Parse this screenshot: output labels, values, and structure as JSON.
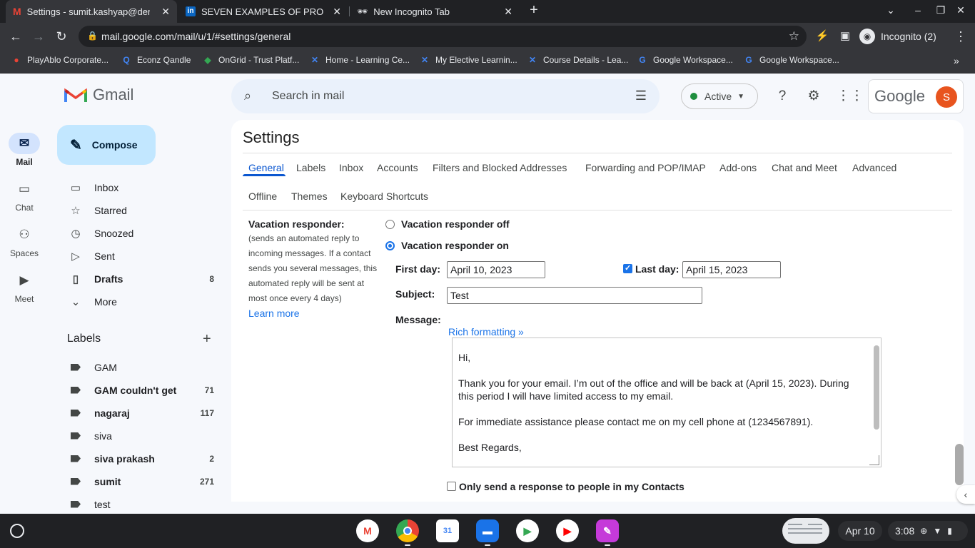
{
  "browser": {
    "tabs": [
      {
        "title": "Settings - sumit.kashyap@demo",
        "icon": "gmail-icon"
      },
      {
        "title": "SEVEN EXAMPLES OF PROFESS",
        "icon": "linkedin-icon"
      },
      {
        "title": "New Incognito Tab",
        "icon": "incognito-icon"
      }
    ],
    "url": "mail.google.com/mail/u/1/#settings/general",
    "profile_label": "Incognito (2)",
    "bookmarks": [
      "PlayAblo Corporate...",
      "Econz Qandle",
      "OnGrid - Trust Platf...",
      "Home - Learning Ce...",
      "My Elective Learnin...",
      "Course Details - Lea...",
      "Google Workspace...",
      "Google Workspace..."
    ]
  },
  "gmail": {
    "brand": "Gmail",
    "rail": [
      {
        "label": "Mail",
        "icon": "mail-icon"
      },
      {
        "label": "Chat",
        "icon": "chat-icon"
      },
      {
        "label": "Spaces",
        "icon": "spaces-icon"
      },
      {
        "label": "Meet",
        "icon": "meet-icon"
      }
    ],
    "compose_label": "Compose",
    "nav": [
      {
        "label": "Inbox",
        "count": "",
        "icon": "inbox-icon"
      },
      {
        "label": "Starred",
        "count": "",
        "icon": "star-icon"
      },
      {
        "label": "Snoozed",
        "count": "",
        "icon": "clock-icon"
      },
      {
        "label": "Sent",
        "count": "",
        "icon": "send-icon"
      },
      {
        "label": "Drafts",
        "count": "8",
        "icon": "draft-icon"
      },
      {
        "label": "More",
        "count": "",
        "icon": "chevron-down-icon"
      }
    ],
    "labels_heading": "Labels",
    "labels": [
      {
        "label": "GAM",
        "count": ""
      },
      {
        "label": "GAM couldn't get",
        "count": "71"
      },
      {
        "label": "nagaraj",
        "count": "117"
      },
      {
        "label": "siva",
        "count": ""
      },
      {
        "label": "siva prakash",
        "count": "2"
      },
      {
        "label": "sumit",
        "count": "271"
      },
      {
        "label": "test",
        "count": ""
      }
    ],
    "search_placeholder": "Search in mail",
    "status": "Active",
    "account_brand": "Google",
    "avatar_letter": "S"
  },
  "settings": {
    "title": "Settings",
    "tabs_row1": [
      "General",
      "Labels",
      "Inbox",
      "Accounts",
      "Filters and Blocked Addresses",
      "Forwarding and POP/IMAP",
      "Add-ons",
      "Chat and Meet",
      "Advanced"
    ],
    "tabs_row2": [
      "Offline",
      "Themes",
      "Keyboard Shortcuts"
    ],
    "vacation": {
      "heading": "Vacation responder:",
      "description": "(sends an automated reply to incoming messages. If a contact sends you several messages, this automated reply will be sent at most once every 4 days)",
      "learn_more": "Learn more",
      "off_label": "Vacation responder off",
      "on_label": "Vacation responder on",
      "first_day_label": "First day:",
      "first_day_value": "April 10, 2023",
      "last_day_label": "Last day:",
      "last_day_value": "April 15, 2023",
      "subject_label": "Subject:",
      "subject_value": "Test",
      "message_label": "Message:",
      "rich_formatting": "Rich formatting »",
      "message_lines": {
        "l1": "Hi,",
        "l2": "Thank you for your email. I’m out of the office and will be back at (April 15, 2023). During this period I will have limited access to my email.",
        "l3": "For immediate assistance please contact me on my cell phone at (1234567891).",
        "l4": "Best Regards,"
      },
      "contacts_only_label": "Only send a response to people in my Contacts"
    }
  },
  "shelf": {
    "date": "Apr 10",
    "time": "3:08"
  },
  "colors": {
    "accent": "#0b57d0",
    "compose_bg": "#c2e7ff",
    "active_dot": "#1e8e3e"
  }
}
